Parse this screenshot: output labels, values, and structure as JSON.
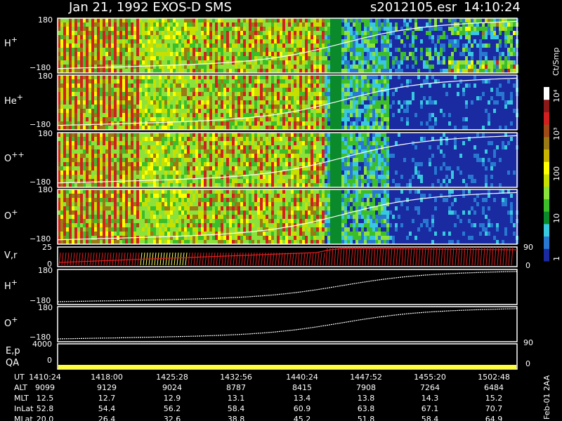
{
  "header": {
    "title": "Jan 21, 1992   EXOS-D SMS",
    "file": "s2012105.esr",
    "clock": "14:10:24"
  },
  "colorbar": {
    "unit": "Ct/Smp",
    "labels": [
      "1",
      "10",
      "100",
      "10³",
      "10⁴"
    ],
    "colors": [
      "#1a2aa0",
      "#2878d2",
      "#38c8e0",
      "#0a8a2a",
      "#3cbe2a",
      "#8ae23a",
      "#c8e000",
      "#ffff00",
      "#c8b400",
      "#9a7a14",
      "#a04a18",
      "#d22020",
      "#8a1a1a",
      "#ffffff"
    ]
  },
  "footer": {
    "stamp": "Feb-01 2AA"
  },
  "chart_data": [
    {
      "type": "heatmap",
      "panels": [
        {
          "label": "H",
          "sup": "+",
          "ymax": "180",
          "ymin": "−180"
        },
        {
          "label": "He",
          "sup": "+",
          "ymax": "180",
          "ymin": "−180"
        },
        {
          "label": "O",
          "sup": "++",
          "ymax": "180",
          "ymin": "−180"
        },
        {
          "label": "O",
          "sup": "+",
          "ymax": "180",
          "ymin": "−180"
        }
      ],
      "xlabels": [
        "1410:24",
        "1418:00",
        "1425:28",
        "1432:56",
        "1440:24",
        "1447:52",
        "1455:20",
        "1502:48"
      ]
    },
    {
      "type": "line",
      "label": "V,r",
      "ylabels": [
        "25",
        "0"
      ],
      "right_labels": [
        "90",
        "0"
      ]
    },
    {
      "type": "line",
      "panels": [
        {
          "label": "H",
          "sup": "+",
          "ymax": "180",
          "ymin": "−180"
        },
        {
          "label": "O",
          "sup": "+",
          "ymax": "180",
          "ymin": "−180"
        }
      ]
    },
    {
      "type": "line",
      "label1": "E,p",
      "label2": "QA",
      "ylabels": [
        "4000",
        "0"
      ],
      "right_labels": [
        "90",
        "0"
      ]
    },
    {
      "type": "table",
      "rows": [
        {
          "label": "UT",
          "values": [
            "1410:24",
            "1418:00",
            "1425:28",
            "1432:56",
            "1440:24",
            "1447:52",
            "1455:20",
            "1502:48"
          ]
        },
        {
          "label": "ALT",
          "values": [
            "9099",
            "9129",
            "9024",
            "8787",
            "8415",
            "7908",
            "7264",
            "6484"
          ]
        },
        {
          "label": "MLT",
          "values": [
            "12.5",
            "12.7",
            "12.9",
            "13.1",
            "13.4",
            "13.8",
            "14.3",
            "15.2"
          ]
        },
        {
          "label": "InLat",
          "values": [
            "52.8",
            "54.4",
            "56.2",
            "58.4",
            "60.9",
            "63.8",
            "67.1",
            "70.7"
          ]
        },
        {
          "label": "MLat",
          "values": [
            "20.0",
            "26.4",
            "32.6",
            "38.8",
            "45.2",
            "51.8",
            "58.4",
            "64.9"
          ]
        }
      ]
    }
  ]
}
